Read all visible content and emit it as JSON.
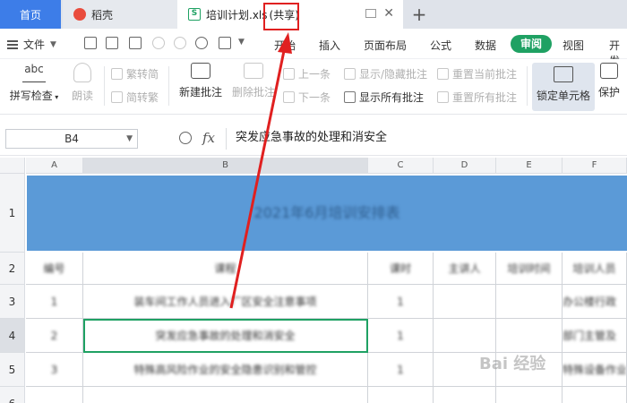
{
  "tabs": {
    "home": "首页",
    "daoke": "稻壳",
    "file_name": "培训计划.xls",
    "file_shared": "(共享)"
  },
  "menu": {
    "file": "文件",
    "items": [
      "开始",
      "插入",
      "页面布局",
      "公式",
      "数据",
      "审阅",
      "视图",
      "开发"
    ],
    "active": "审阅"
  },
  "ribbon": {
    "spell_check": "拼写检查",
    "spell_icon_text": "abc",
    "read_aloud": "朗读",
    "trad_to_simp": "繁转简",
    "simp_to_trad": "简转繁",
    "new_comment": "新建批注",
    "delete_comment": "删除批注",
    "prev": "上一条",
    "next": "下一条",
    "show_hide_comments": "显示/隐藏批注",
    "show_all_comments": "显示所有批注",
    "reset_current_comment": "重置当前批注",
    "reset_all_comments": "重置所有批注",
    "lock_cell": "锁定单元格",
    "protect": "保护"
  },
  "formula_bar": {
    "name_box": "B4",
    "fx": "fx",
    "content": "突发应急事故的处理和消安全"
  },
  "grid": {
    "columns": [
      "A",
      "B",
      "C",
      "D",
      "E",
      "F"
    ],
    "rows": [
      "1",
      "2",
      "3",
      "4",
      "5",
      "6"
    ],
    "title": "2021年6月培训安排表",
    "headers": [
      "编号",
      "课程",
      "课时",
      "主讲人",
      "培训时间",
      "培训人员"
    ],
    "data": [
      [
        "1",
        "装车间工作人员进入厂区安全注意事项",
        "1",
        "",
        "",
        "办公楼行政"
      ],
      [
        "2",
        "突发应急事故的处理和消安全",
        "1",
        "",
        "",
        "部门主管及"
      ],
      [
        "3",
        "特殊高风险作业的安全隐患识别和管控",
        "1",
        "",
        "",
        "特殊设备作业"
      ]
    ]
  },
  "watermark": "Bai 经验",
  "colors": {
    "accent_green": "#1fa163",
    "tab_blue": "#3d7de8",
    "title_band": "#5b9ad7",
    "annotation_red": "#e02020"
  }
}
